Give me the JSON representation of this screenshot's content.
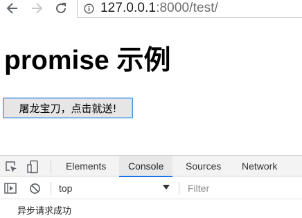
{
  "browser": {
    "url_host": "127.0.0.1",
    "url_rest": ":8000/test/",
    "icons": {
      "back": "arrow-left-icon",
      "forward": "arrow-right-icon",
      "reload": "reload-icon",
      "site_info": "info-icon"
    }
  },
  "page": {
    "title": "promise 示例",
    "button_label": "屠龙宝刀，点击就送!"
  },
  "devtools": {
    "tabs": [
      {
        "label": "Elements"
      },
      {
        "label": "Console",
        "active": true
      },
      {
        "label": "Sources"
      },
      {
        "label": "Network"
      }
    ],
    "console": {
      "context": "top",
      "filter_placeholder": "Filter",
      "messages": [
        "异步请求成功"
      ]
    },
    "colors": {
      "active_tab_underline": "#1a73e8",
      "panel_background": "#f3f3f3",
      "button_focus_border": "#4d8fd8"
    }
  }
}
